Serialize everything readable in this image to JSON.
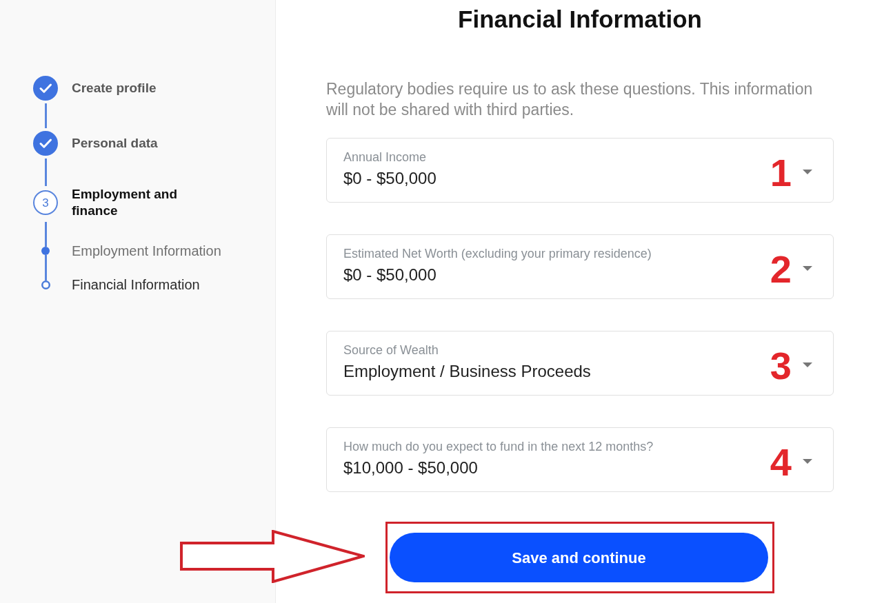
{
  "sidebar": {
    "steps": [
      {
        "label": "Create profile",
        "completed": true,
        "active": false
      },
      {
        "label": "Personal data",
        "completed": true,
        "active": false
      },
      {
        "label": "Employment and finance",
        "number": "3",
        "completed": false,
        "active": true,
        "children": [
          {
            "label": "Employment Information",
            "completed": true,
            "active": false
          },
          {
            "label": "Financial Information",
            "completed": false,
            "active": true
          }
        ]
      }
    ]
  },
  "main": {
    "title": "Financial Information",
    "intro": "Regulatory bodies require us to ask these questions. This information will not be shared with third parties.",
    "fields": [
      {
        "label": "Annual Income",
        "value": "$0 - $50,000",
        "marker": "1"
      },
      {
        "label": "Estimated Net Worth (excluding your primary residence)",
        "value": "$0 - $50,000",
        "marker": "2"
      },
      {
        "label": "Source of Wealth",
        "value": "Employment / Business Proceeds",
        "marker": "3"
      },
      {
        "label": "How much do you expect to fund in the next 12 months?",
        "value": "$10,000 - $50,000",
        "marker": "4"
      }
    ],
    "submit_button": {
      "label": "Save and continue",
      "highlighted": true
    }
  }
}
